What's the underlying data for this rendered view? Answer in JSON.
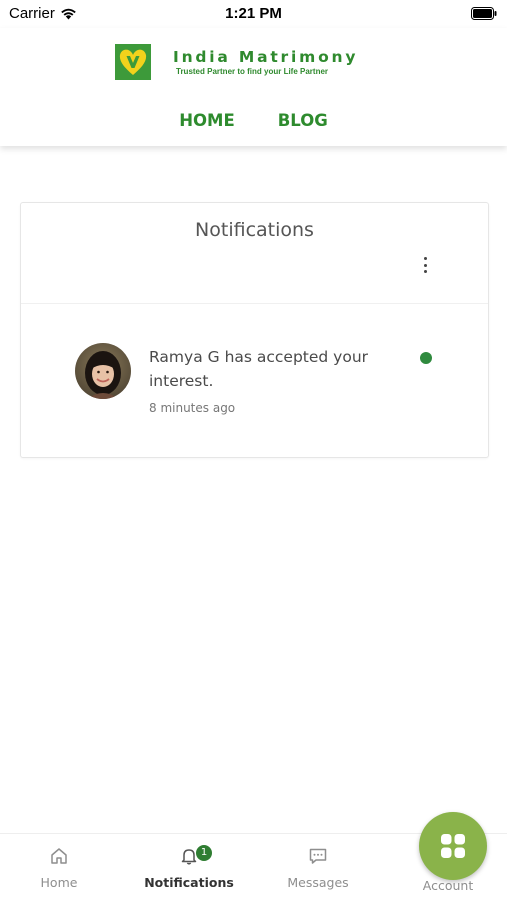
{
  "status_bar": {
    "carrier": "Carrier",
    "time": "1:21 PM"
  },
  "header": {
    "brand_name": "India Matrimony",
    "tagline": "Trusted Partner to find your Life Partner",
    "nav": [
      {
        "label": "HOME"
      },
      {
        "label": "BLOG"
      }
    ]
  },
  "notifications_card": {
    "title": "Notifications",
    "items": [
      {
        "message": "Ramya G has accepted your interest.",
        "time_ago": "8 minutes ago",
        "unread": true
      }
    ]
  },
  "bottom_nav": {
    "tabs": [
      {
        "label": "Home",
        "icon": "home-icon",
        "active": false
      },
      {
        "label": "Notifications",
        "icon": "bell-icon",
        "active": true,
        "badge": "1"
      },
      {
        "label": "Messages",
        "icon": "message-icon",
        "active": false
      },
      {
        "label": "Account",
        "icon": "grid-icon",
        "active": false
      }
    ]
  },
  "colors": {
    "brand_green": "#2f8a2e",
    "fab_green": "#8ab34a",
    "unread_dot": "#2f8a3e",
    "badge_green": "#2f7d32"
  }
}
